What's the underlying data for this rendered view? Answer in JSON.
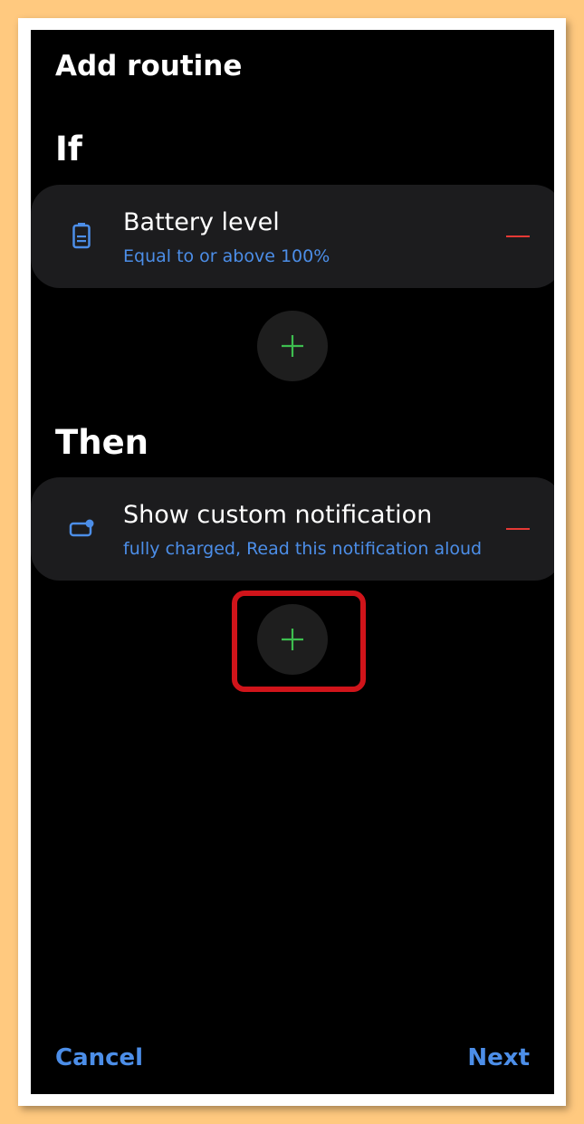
{
  "header": {
    "title": "Add routine"
  },
  "if_section": {
    "title": "If",
    "condition": {
      "icon": "battery-icon",
      "title": "Battery level",
      "subtitle": "Equal to or above 100%"
    }
  },
  "then_section": {
    "title": "Then",
    "action": {
      "icon": "notification-icon",
      "title": "Show custom notification",
      "subtitle": "fully charged, Read this notification aloud"
    }
  },
  "footer": {
    "cancel_label": "Cancel",
    "next_label": "Next"
  },
  "colors": {
    "background": "#000000",
    "card": "#1C1C1E",
    "accent_blue": "#4C8EE8",
    "add_green": "#3DBE4F",
    "remove_red": "#E53935",
    "highlight_red": "#D0141A"
  }
}
